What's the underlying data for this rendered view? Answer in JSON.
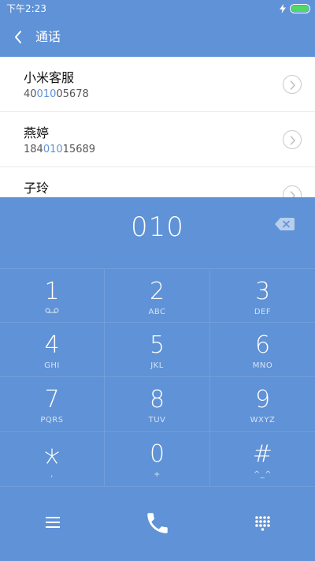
{
  "status_bar": {
    "time": "下午2:23",
    "icons": [
      "charging-bolt-icon",
      "battery-icon"
    ],
    "battery_color": "#4cd964"
  },
  "header": {
    "title": "通话",
    "back_icon": "chevron-left-icon"
  },
  "contacts": [
    {
      "name": "小米客服",
      "number_before": "40",
      "number_match": "010",
      "number_after": "05678"
    },
    {
      "name": "燕婷",
      "number_before": "184",
      "number_match": "010",
      "number_after": "15689"
    },
    {
      "name": "子玲",
      "number_before": "",
      "number_match": "",
      "number_after": ""
    }
  ],
  "dialer": {
    "input": "010",
    "backspace_icon": "backspace-icon",
    "keys": [
      {
        "digit": "1",
        "letters": ""
      },
      {
        "digit": "2",
        "letters": "ABC"
      },
      {
        "digit": "3",
        "letters": "DEF"
      },
      {
        "digit": "4",
        "letters": "GHI"
      },
      {
        "digit": "5",
        "letters": "JKL"
      },
      {
        "digit": "6",
        "letters": "MNO"
      },
      {
        "digit": "7",
        "letters": "PQRS"
      },
      {
        "digit": "8",
        "letters": "TUV"
      },
      {
        "digit": "9",
        "letters": "WXYZ"
      },
      {
        "digit": "",
        "letters": ","
      },
      {
        "digit": "0",
        "letters": "+"
      },
      {
        "digit": "#",
        "letters": "^_^"
      }
    ]
  },
  "bottom_bar": {
    "icons": [
      "menu-icon",
      "phone-icon",
      "dialpad-icon"
    ]
  },
  "colors": {
    "accent": "#5f92d6",
    "list_background": "#ffffff",
    "highlight": "#5f92d6"
  }
}
